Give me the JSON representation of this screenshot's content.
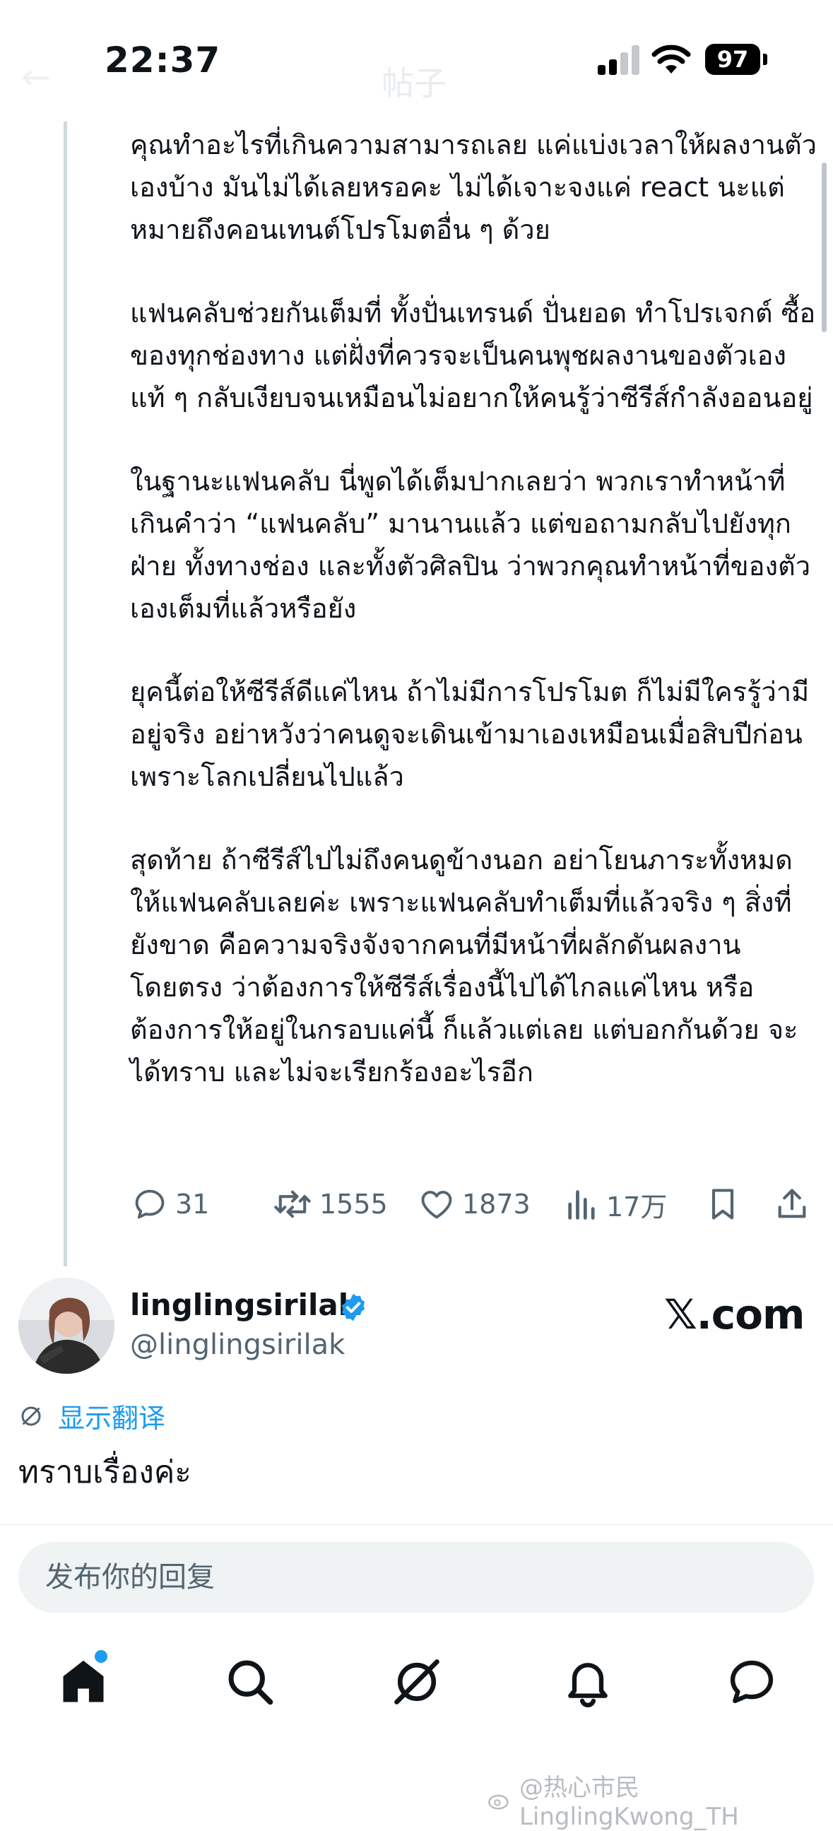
{
  "status_bar": {
    "time": "22:37",
    "battery": "97",
    "signal_icon": "cellular-signal-icon",
    "wifi_icon": "wifi-icon"
  },
  "header": {
    "title_ghost": "帖子",
    "back_icon": "back-arrow-icon"
  },
  "post": {
    "paragraphs": [
      "คุณทำอะไรที่เกินความสามารถเลย แค่แบ่งเวลาให้ผลงานตัวเองบ้าง มันไม่ได้เลยหรอคะ ไม่ได้เจาะจงแค่ react นะแต่หมายถึงคอนเทนต์โปรโมตอื่น ๆ ด้วย",
      "แฟนคลับช่วยกันเต็มที่ ทั้งปั่นเทรนด์ ปั่นยอด ทำโปรเจกต์ ซื้อของทุกช่องทาง แต่ฝั่งที่ควรจะเป็นคนพุชผลงานของตัวเองแท้ ๆ กลับเงียบจนเหมือนไม่อยากให้คนรู้ว่าซีรีส์กำลังออนอยู่",
      "ในฐานะแฟนคลับ นี่พูดได้เต็มปากเลยว่า พวกเราทำหน้าที่เกินคำว่า “แฟนคลับ” มานานแล้ว แต่ขอถามกลับไปยังทุกฝ่าย ทั้งทางช่อง และทั้งตัวศิลปิน ว่าพวกคุณทำหน้าที่ของตัวเองเต็มที่แล้วหรือยัง",
      "ยุคนี้ต่อให้ซีรีส์ดีแค่ไหน ถ้าไม่มีการโปรโมต ก็ไม่มีใครรู้ว่ามีอยู่จริง อย่าหวังว่าคนดูจะเดินเข้ามาเองเหมือนเมื่อสิบปีก่อน เพราะโลกเปลี่ยนไปแล้ว",
      "สุดท้าย ถ้าซีรีส์ไปไม่ถึงคนดูข้างนอก อย่าโยนภาระทั้งหมดให้แฟนคลับเลยค่ะ เพราะแฟนคลับทำเต็มที่แล้วจริง ๆ สิ่งที่ยังขาด คือความจริงจังจากคนที่มีหน้าที่ผลักดันผลงานโดยตรง ว่าต้องการให้ซีรีส์เรื่องนี้ไปได้ไกลแค่ไหน หรือต้องการให้อยู่ในกรอบแค่นี้ ก็แล้วแต่เลย แต่บอกกันด้วย จะได้ทราบ และไม่จะเรียกร้องอะไรอีก"
    ],
    "actions": {
      "replies": "31",
      "reposts": "1555",
      "likes": "1873",
      "views": "17万"
    }
  },
  "reply": {
    "author_name": "linglingsirilak",
    "author_handle": "@linglingsirilak",
    "source": "𝕏.com",
    "translate_label": "显示翻译",
    "text": "ทราบเรื่องค่ะ"
  },
  "composer": {
    "placeholder": "发布你的回复"
  },
  "nav": {
    "items": [
      "home-icon",
      "search-icon",
      "grok-icon",
      "notifications-icon",
      "messages-icon"
    ],
    "accent": "#1d9bf0"
  },
  "watermark": "@热心市民LinglingKwong_TH"
}
